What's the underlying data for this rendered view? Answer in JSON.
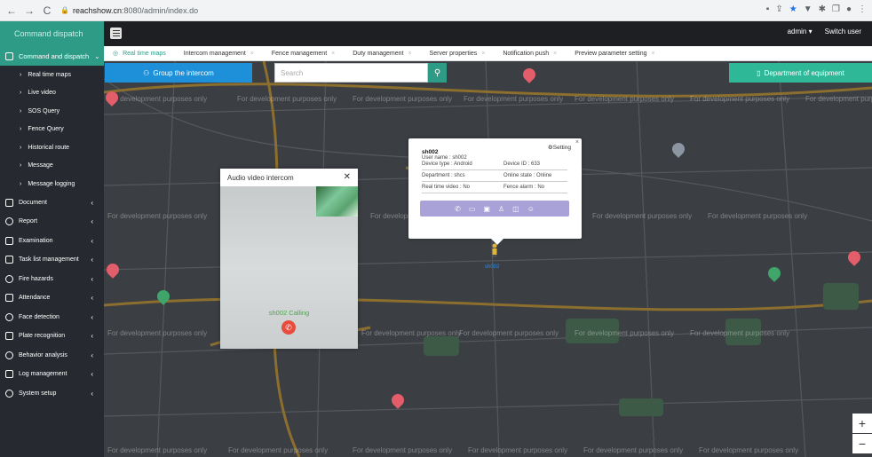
{
  "browser": {
    "url_prefix": "reachshow.cn",
    "url_rest": ":8080/admin/index.do",
    "nav": [
      "←",
      "→",
      "C"
    ]
  },
  "header": {
    "brand": "Command dispatch",
    "user": "admin",
    "switch_user": "Switch user"
  },
  "sidebar": {
    "group": "Command and dispatch",
    "sub_items": [
      "Real time maps",
      "Live video",
      "SOS Query",
      "Fence Query",
      "Historical route",
      "Message",
      "Message logging"
    ],
    "items": [
      "Document",
      "Report",
      "Examination",
      "Task list management",
      "Fire hazards",
      "Attendance",
      "Face detection",
      "Plate recognition",
      "Behavior analysis",
      "Log management",
      "System setup"
    ]
  },
  "tabs": [
    "Real time maps",
    "Intercom management",
    "Fence management",
    "Duty management",
    "Server properties",
    "Notification push",
    "Preview parameter setting"
  ],
  "toolbar": {
    "group_intercom": "Group the intercom",
    "search_placeholder": "Search",
    "department": "Department of equipment"
  },
  "map": {
    "watermark": "For development purposes only"
  },
  "video_dialog": {
    "title": "Audio video intercom",
    "calling": "sh002 Calling"
  },
  "popup": {
    "setting": "Setting",
    "name": "sh002",
    "user_name": "User name : sh002",
    "device_type": "Device type : Android",
    "device_id": "Device ID : 633",
    "department": "Department : shcs",
    "online_state": "Online state : Online",
    "real_time_video": "Real time video : No",
    "fence_alarm": "Fence alarm : No"
  },
  "device_label": "sh002",
  "colors": {
    "accent": "#2e9b87",
    "blue": "#1e90d9",
    "sidebar": "#262a30",
    "map": "#3b3e43"
  }
}
